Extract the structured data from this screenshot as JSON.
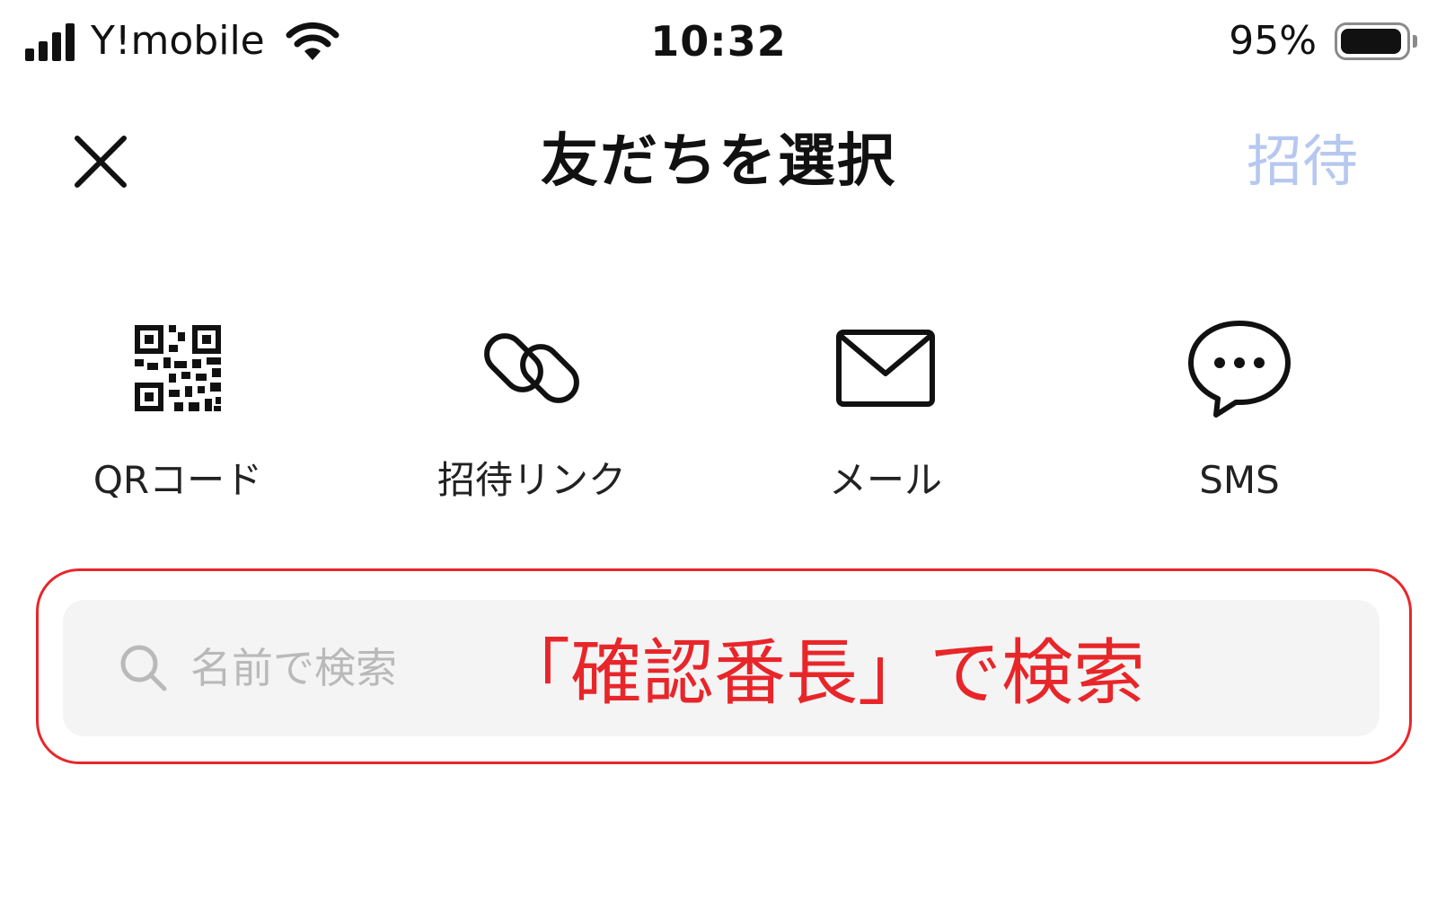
{
  "status_bar": {
    "carrier": "Y!mobile",
    "time": "10:32",
    "battery_percent": "95%",
    "battery_level": 0.95,
    "signal_bars": 4,
    "signal_icon": "cellular-signal-icon",
    "wifi_icon": "wifi-icon",
    "battery_icon": "battery-icon"
  },
  "header": {
    "title": "友だちを選択",
    "invite_label": "招待",
    "invite_color": "#b6c8f0",
    "close_icon": "close-icon"
  },
  "options": [
    {
      "label": "QRコード",
      "icon": "qr-code-icon"
    },
    {
      "label": "招待リンク",
      "icon": "link-icon"
    },
    {
      "label": "メール",
      "icon": "mail-icon"
    },
    {
      "label": "SMS",
      "icon": "chat-bubble-icon"
    }
  ],
  "search": {
    "placeholder": "名前で検索",
    "value": "",
    "icon": "search-icon"
  },
  "annotation": {
    "text": "「確認番長」で検索",
    "color": "#e8262a"
  }
}
